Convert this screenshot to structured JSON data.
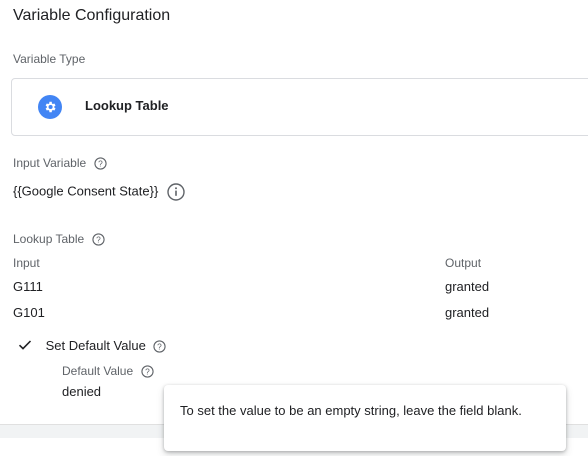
{
  "header": {
    "title": "Variable Configuration"
  },
  "variable_type": {
    "label": "Variable Type",
    "value": "Lookup Table",
    "icon": "gear-icon",
    "icon_color": "#4285f4"
  },
  "input_variable": {
    "label": "Input Variable",
    "value": "{{Google Consent State}}"
  },
  "lookup_table": {
    "label": "Lookup Table",
    "columns": {
      "input": "Input",
      "output": "Output"
    },
    "rows": [
      {
        "input": "G111",
        "output": "granted"
      },
      {
        "input": "G101",
        "output": "granted"
      }
    ]
  },
  "default": {
    "checkbox_label": "Set Default Value",
    "checked": true,
    "value_label": "Default Value",
    "value": "denied"
  },
  "tooltip": {
    "text": "To set the value to be an empty string, leave the field blank."
  }
}
